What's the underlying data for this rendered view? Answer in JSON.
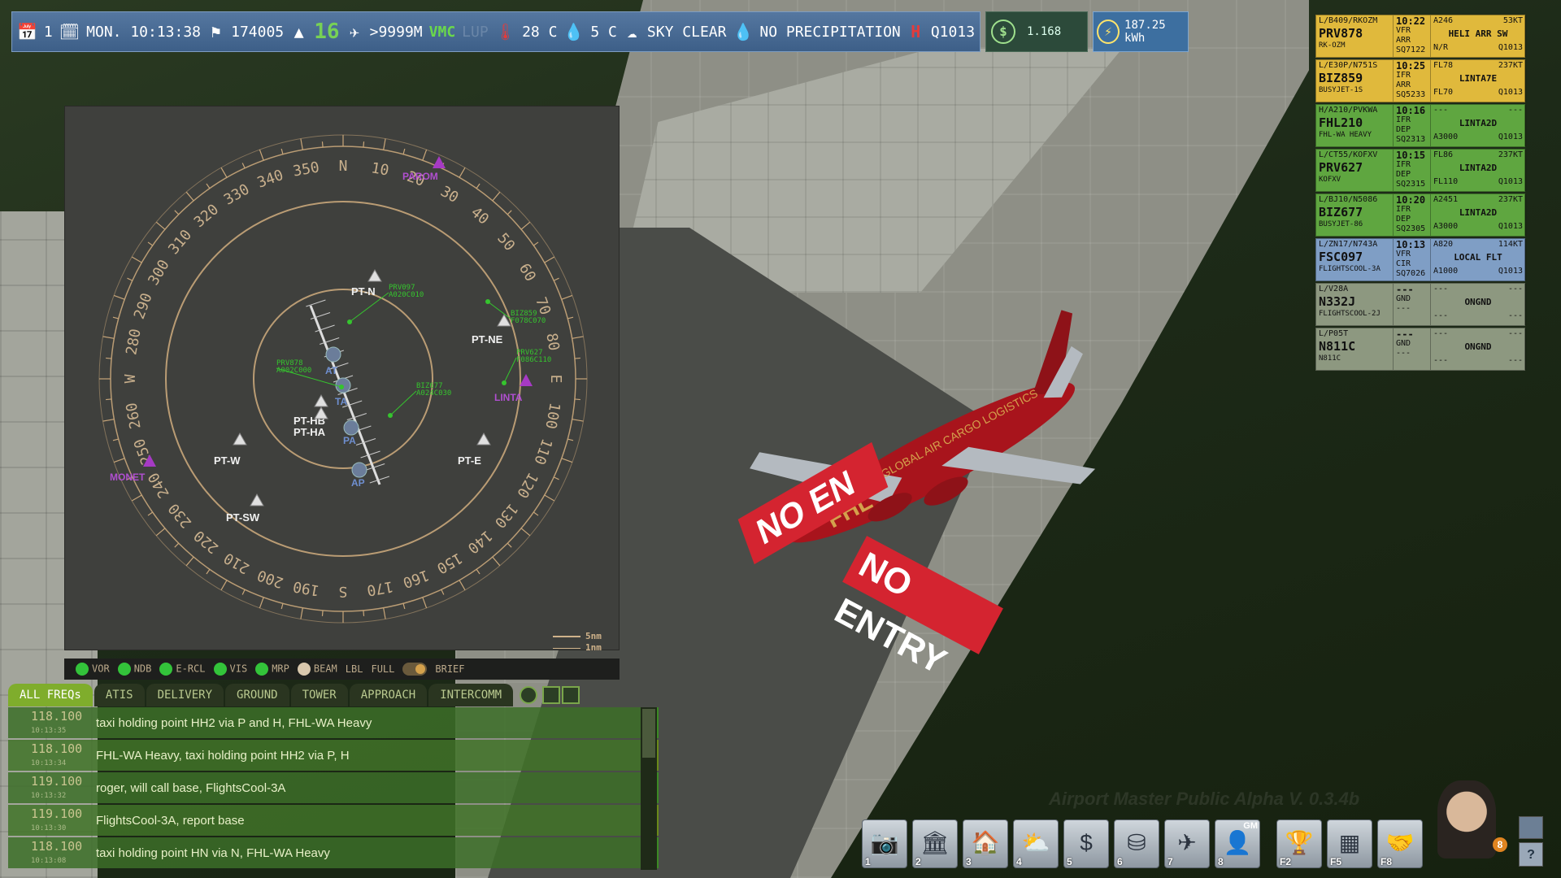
{
  "topbar": {
    "day_number": "1",
    "datetime": "MON. 10:13:38",
    "traffic_count": "174005",
    "runway": "16",
    "visibility": ">9999M",
    "vmc": "VMC",
    "lup": "LUP",
    "temperature": "28 C",
    "dewpoint": "5 C",
    "sky": "SKY CLEAR",
    "precipitation": "NO PRECIPITATION",
    "qnh": "Q1013",
    "money": "1.168",
    "energy": "187.25 kWh",
    "icons": [
      "calendar-icon",
      "clock-calendar-icon",
      "windsock-icon",
      "runway-icon",
      "wind-aircraft-icon",
      "thermometer-icon",
      "dewpoint-icon",
      "cloud-icon",
      "raindrops-icon",
      "pressure-icon",
      "dollar-icon",
      "bolt-icon"
    ]
  },
  "strips": [
    {
      "color": "yellow",
      "route": "L/B409/RKOZM",
      "callsign": "PRV878",
      "operator": "RK-OZM",
      "time": "10:22",
      "rules": "VFR",
      "type": "ARR",
      "squawk": "SQ7122",
      "alt": "A246",
      "speed": "53KT",
      "dest": "HELI ARR SW",
      "rfl": "N/R",
      "qnh": "Q1013"
    },
    {
      "color": "yellow",
      "route": "L/E30P/N751S",
      "callsign": "BIZ859",
      "operator": "BUSYJET-1S",
      "time": "10:25",
      "rules": "IFR",
      "type": "ARR",
      "squawk": "SQ5233",
      "alt": "FL78",
      "speed": "237KT",
      "dest": "LINTA7E",
      "rfl": "FL70",
      "qnh": "Q1013"
    },
    {
      "color": "green",
      "route": "H/A210/PVKWA",
      "callsign": "FHL210",
      "operator": "FHL-WA HEAVY",
      "time": "10:16",
      "rules": "IFR",
      "type": "DEP",
      "squawk": "SQ2313",
      "alt": "---",
      "speed": "---",
      "dest": "LINTA2D",
      "rfl": "A3000",
      "qnh": "Q1013"
    },
    {
      "color": "green",
      "route": "L/CT55/KOFXV",
      "callsign": "PRV627",
      "operator": "KOFXV",
      "time": "10:15",
      "rules": "IFR",
      "type": "DEP",
      "squawk": "SQ2315",
      "alt": "FL86",
      "speed": "237KT",
      "dest": "LINTA2D",
      "rfl": "FL110",
      "qnh": "Q1013"
    },
    {
      "color": "green",
      "route": "L/BJ10/N5086",
      "callsign": "BIZ677",
      "operator": "BUSYJET-86",
      "time": "10:20",
      "rules": "IFR",
      "type": "DEP",
      "squawk": "SQ2305",
      "alt": "A2451",
      "speed": "237KT",
      "dest": "LINTA2D",
      "rfl": "A3000",
      "qnh": "Q1013"
    },
    {
      "color": "blue",
      "route": "L/ZN17/N743A",
      "callsign": "FSC097",
      "operator": "FLIGHTSCOOL-3A",
      "time": "10:13",
      "rules": "VFR",
      "type": "CIR",
      "squawk": "SQ7026",
      "alt": "A820",
      "speed": "114KT",
      "dest": "LOCAL FLT",
      "rfl": "A1000",
      "qnh": "Q1013"
    },
    {
      "color": "gray",
      "route": "L/V28A",
      "callsign": "N332J",
      "operator": "FLIGHTSCOOL-2J",
      "time": "---",
      "rules": "",
      "type": "GND",
      "squawk": "---",
      "alt": "---",
      "speed": "---",
      "dest": "ONGND",
      "rfl": "---",
      "qnh": "---"
    },
    {
      "color": "gray",
      "route": "L/P05T",
      "callsign": "N811C",
      "operator": "N811C",
      "time": "---",
      "rules": "",
      "type": "GND",
      "squawk": "---",
      "alt": "---",
      "speed": "---",
      "dest": "ONGND",
      "rfl": "---",
      "qnh": "---"
    }
  ],
  "radar": {
    "bearings": [
      "N",
      "10",
      "20",
      "30",
      "40",
      "50",
      "60",
      "70",
      "80",
      "E",
      "100",
      "110",
      "120",
      "130",
      "140",
      "150",
      "160",
      "170",
      "S",
      "190",
      "200",
      "210",
      "220",
      "230",
      "240",
      "250",
      "260",
      "W",
      "280",
      "290",
      "300",
      "310",
      "320",
      "330",
      "340",
      "350"
    ],
    "waypoints": [
      {
        "label": "PT-N"
      },
      {
        "label": "PT-NE"
      },
      {
        "label": "PT-HB"
      },
      {
        "label": "PT-HA"
      },
      {
        "label": "PT-W"
      },
      {
        "label": "PT-E"
      },
      {
        "label": "PT-SW"
      }
    ],
    "fixes": [
      {
        "label": "PAROM"
      },
      {
        "label": "LINTA"
      },
      {
        "label": "MONET"
      }
    ],
    "runway_labels": [
      "AT",
      "TA",
      "PA",
      "AP"
    ],
    "traffic": [
      {
        "line1": "PRV097",
        "line2": "A020C010"
      },
      {
        "line1": "BIZ859",
        "line2": "F078C070"
      },
      {
        "line1": "PRV627",
        "line2": "F086C110"
      },
      {
        "line1": "PRV878",
        "line2": "A002C000"
      },
      {
        "line1": "BIZ677",
        "line2": "A024C030"
      }
    ],
    "scale": [
      {
        "label": "5nm"
      },
      {
        "label": "1nm"
      }
    ],
    "footer": {
      "vor": "VOR",
      "ndb": "NDB",
      "ercl": "E-RCL",
      "vis": "VIS",
      "mrp": "MRP",
      "beam": "BEAM",
      "lbl": "LBL",
      "full": "FULL",
      "brief": "BRIEF"
    }
  },
  "comms": {
    "tabs": [
      "ALL FREQs",
      "ATIS",
      "DELIVERY",
      "GROUND",
      "TOWER",
      "APPROACH",
      "INTERCOMM"
    ],
    "active_tab": "ALL FREQs",
    "messages": [
      {
        "freq": "118.100",
        "time": "10:13:35",
        "text": "taxi holding point HH2 via P and H, FHL-WA Heavy"
      },
      {
        "freq": "118.100",
        "time": "10:13:34",
        "text": "FHL-WA Heavy, taxi holding point HH2 via P, H"
      },
      {
        "freq": "119.100",
        "time": "10:13:32",
        "text": "roger, will call base, FlightsCool-3A"
      },
      {
        "freq": "119.100",
        "time": "10:13:30",
        "text": "FlightsCool-3A, report base"
      },
      {
        "freq": "118.100",
        "time": "10:13:08",
        "text": "taxi holding point HN via N, FHL-WA Heavy"
      }
    ]
  },
  "scene": {
    "watermark": "Airport Master Public Alpha V. 0.3.4b",
    "aircraft_livery": "GLOBAL AIR CARGO LOGISTICS",
    "aircraft_tail": "FHL",
    "no_entry": "NO ENTRY",
    "no_entry_partial": "NO EN"
  },
  "toolbar": {
    "buttons": [
      {
        "num": "1",
        "icon": "camera-icon"
      },
      {
        "num": "2",
        "icon": "terminal-icon"
      },
      {
        "num": "3",
        "icon": "hangar-icon"
      },
      {
        "num": "4",
        "icon": "weather-icon"
      },
      {
        "num": "5",
        "icon": "dollar-icon"
      },
      {
        "num": "6",
        "icon": "fuel-tank-icon"
      },
      {
        "num": "7",
        "icon": "aircraft-icon"
      },
      {
        "num": "8",
        "icon": "manager-icon",
        "badge": "GM"
      },
      {
        "num": "F2",
        "icon": "trophy-icon"
      },
      {
        "num": "F5",
        "icon": "schedule-icon"
      },
      {
        "num": "F8",
        "icon": "handshake-icon"
      }
    ],
    "avatar_badge": "8"
  },
  "colors": {
    "topbar": "#4a6c95",
    "strip_yellow": "#e0b93c",
    "strip_green": "#5fa640",
    "strip_blue": "#7f9ec5",
    "strip_gray": "#8d9880",
    "radar_bg": "#3f403d",
    "radar_ring": "#c8a67a",
    "radar_traffic": "#35c42e",
    "radar_fix": "#a63ac4",
    "comm_row": "#3c6e28"
  }
}
